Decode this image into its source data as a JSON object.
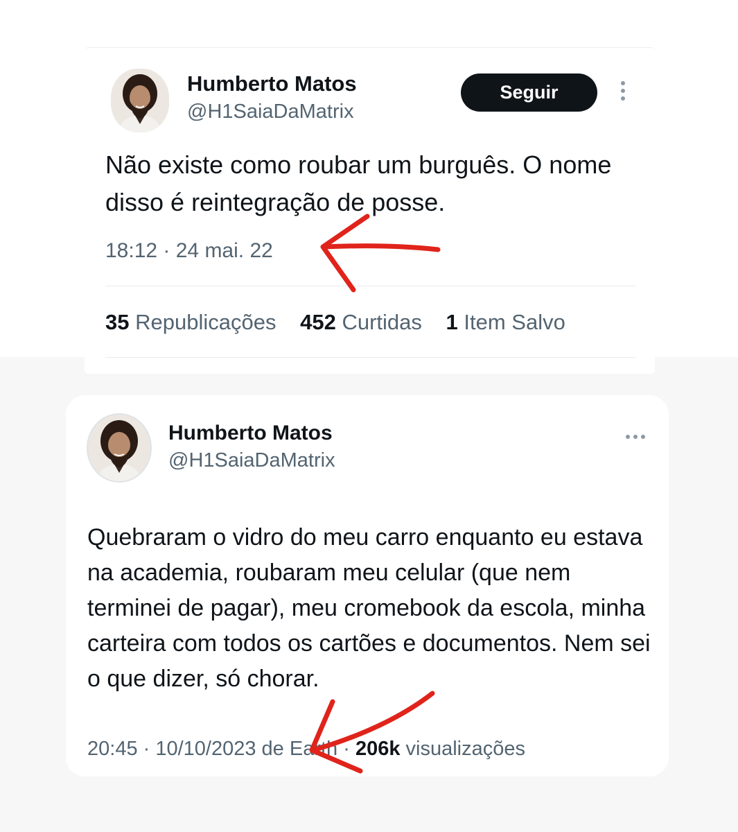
{
  "tweet1": {
    "author_name": "Humberto Matos",
    "author_handle": "@H1SaiaDaMatrix",
    "follow_label": "Seguir",
    "text": "Não existe como roubar um burguês. O nome disso é reintegração de posse.",
    "timestamp": "18:12 · 24 mai. 22",
    "stats": {
      "reposts_count": "35",
      "reposts_label": "Republicações",
      "likes_count": "452",
      "likes_label": "Curtidas",
      "saved_count": "1",
      "saved_label": "Item Salvo"
    },
    "icons": {
      "more": "more-vertical-icon"
    }
  },
  "tweet2": {
    "author_name": "Humberto Matos",
    "author_handle": "@H1SaiaDaMatrix",
    "text": "Quebraram o vidro do meu carro enquanto eu estava na academia, roubaram meu celular (que nem terminei de pagar), meu cromebook da escola, minha carteira com todos os cartões e documentos. Nem sei o que dizer, só chorar.",
    "time_prefix": "20:45 · 10/10/2023 de Earth · ",
    "views_count": "206k",
    "views_label": " visualizações",
    "icons": {
      "more": "more-horizontal-icon"
    }
  },
  "colors": {
    "text_primary": "#0f1419",
    "text_secondary": "#536471",
    "follow_bg": "#0f1419",
    "annotation_arrow": "#e0241b"
  }
}
